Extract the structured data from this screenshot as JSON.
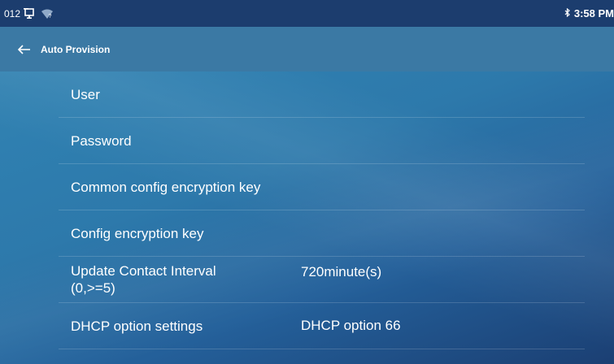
{
  "statusbar": {
    "left_text": "012",
    "time": "3:58 PM"
  },
  "header": {
    "title": "Auto Provision"
  },
  "rows": [
    {
      "label": "User",
      "value": ""
    },
    {
      "label": "Password",
      "value": ""
    },
    {
      "label": "Common config encryption key",
      "value": ""
    },
    {
      "label": "Config encryption key",
      "value": ""
    },
    {
      "label": "Update Contact Interval",
      "label2": "(0,>=5)",
      "value": "720minute(s)"
    },
    {
      "label": "DHCP option settings",
      "value": "DHCP option 66"
    }
  ],
  "icons": [
    "monitor-icon",
    "wifi-icon",
    "bluetooth-icon",
    "back-arrow-icon"
  ]
}
